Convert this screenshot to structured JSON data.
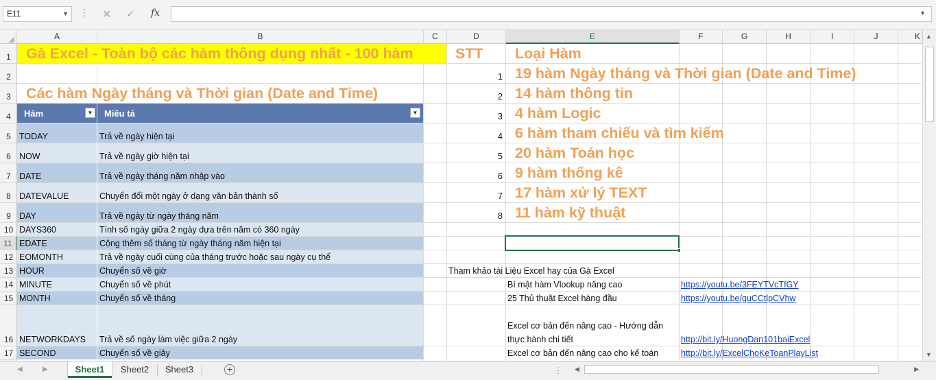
{
  "formula_bar": {
    "name_box": "E11",
    "dots_icon": "⋮",
    "cancel_icon": "✕",
    "enter_icon": "✓",
    "fx_label": "fx",
    "formula_value": ""
  },
  "columns": [
    "A",
    "B",
    "C",
    "D",
    "E",
    "F",
    "G",
    "H",
    "I",
    "J",
    "K"
  ],
  "rows": [
    "1",
    "2",
    "3",
    "4",
    "5",
    "6",
    "7",
    "8",
    "9",
    "10",
    "11",
    "12",
    "13",
    "14",
    "15",
    "16",
    "17"
  ],
  "title": "Gà Excel - Toàn bộ các hàm thông dụng nhất - 100 hàm",
  "section_title": "Các hàm Ngày tháng và Thời gian (Date and Time)",
  "table": {
    "headers": [
      "Hàm",
      "Miêu tả"
    ],
    "rows": [
      {
        "func": "TODAY",
        "desc": "Trả về ngày hiện tại"
      },
      {
        "func": "NOW",
        "desc": "Trả về ngày giờ hiện tại"
      },
      {
        "func": "DATE",
        "desc": "Trả về ngày tháng năm nhập vào"
      },
      {
        "func": "DATEVALUE",
        "desc": "Chuyển đổi một ngày ở dạng văn bản thành số"
      },
      {
        "func": "DAY",
        "desc": "Trả về ngày từ ngày tháng năm"
      },
      {
        "func": "DAYS360",
        "desc": "Tính số ngày giữa 2 ngày dựa trên năm có 360 ngày"
      },
      {
        "func": "EDATE",
        "desc": "Cộng thêm số tháng từ ngày tháng năm hiện tại"
      },
      {
        "func": "EOMONTH",
        "desc": "Trả về ngày cuối cùng của tháng trước hoặc sau ngày cụ thể"
      },
      {
        "func": "HOUR",
        "desc": "Chuyển số về giờ"
      },
      {
        "func": "MINUTE",
        "desc": "Chuyển số về phút"
      },
      {
        "func": "MONTH",
        "desc": "Chuyển số về tháng"
      },
      {
        "func": "NETWORKDAYS",
        "desc": "Trả về số ngày làm việc giữa 2 ngày"
      },
      {
        "func": "SECOND",
        "desc": "Chuyển số về giây"
      }
    ]
  },
  "categories": {
    "stt_header": "STT",
    "type_header": "Loại Hàm",
    "items": [
      {
        "stt": "1",
        "label": "19 hàm Ngày tháng và Thời gian (Date and Time)"
      },
      {
        "stt": "2",
        "label": "14 hàm thông tin"
      },
      {
        "stt": "3",
        "label": "4 hàm Logic"
      },
      {
        "stt": "4",
        "label": "6 hàm tham chiếu và tìm kiếm"
      },
      {
        "stt": "5",
        "label": "20 hàm Toán học"
      },
      {
        "stt": "6",
        "label": "9 hàm thống kê"
      },
      {
        "stt": "7",
        "label": "17 hàm xử lý TEXT"
      },
      {
        "stt": "8",
        "label": "11 hàm kỹ thuật"
      }
    ]
  },
  "references": {
    "heading": "Tham khảo tài Liệu Excel hay của Gà Excel",
    "items": [
      {
        "label": "Bí mật hàm Vlookup nâng cao",
        "url": "https://youtu.be/3FEYTVcTfGY"
      },
      {
        "label": "25 Thủ thuật Excel hàng đầu",
        "url": "https://youtu.be/guCCtlpCVhw"
      },
      {
        "label_line1": "Excel cơ bản đến nâng cao - Hướng dẫn",
        "label_line2": "thực hành chi tiết",
        "url": "http://bit.ly/HuongDan101baiExcel"
      },
      {
        "label": "Excel cơ bản đến nâng cao cho kế toán",
        "url": "http://bit.ly/ExcelChoKeToanPlayList"
      }
    ]
  },
  "sheets": [
    "Sheet1",
    "Sheet2",
    "Sheet3"
  ],
  "active_sheet": "Sheet1",
  "add_sheet_icon": "+",
  "colors": {
    "accent": "#217346",
    "title_bg": "#ffff00",
    "orange_text": "#f1a154",
    "table_header": "#5b79ad",
    "band_dark": "#b8cce4",
    "band_light": "#dce6f1",
    "link": "#0b3fd1"
  }
}
